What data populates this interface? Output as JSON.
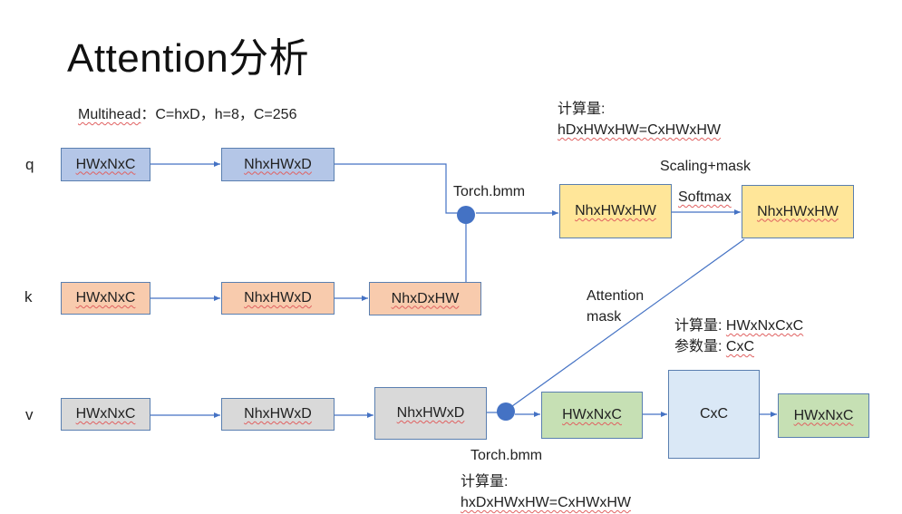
{
  "title": "Attention分析",
  "subtitle": {
    "term": "Multihead",
    "rest": "：C=hxD，h=8，C=256"
  },
  "rows": {
    "q": "q",
    "k": "k",
    "v": "v"
  },
  "boxes": {
    "q1": "HWxNxC",
    "q2": "NhxHWxD",
    "k1": "HWxNxC",
    "k2": "NhxHWxD",
    "k3": "NhxDxHW",
    "v1": "HWxNxC",
    "v2": "NhxHWxD",
    "v3": "NhxHWxD",
    "attn1": "NhxHWxHW",
    "attn2": "NhxHWxHW",
    "out1": "HWxNxC",
    "proj": "CxC",
    "out2": "HWxNxC"
  },
  "labels": {
    "bmm_top": "Torch.bmm",
    "bmm_bottom": "Torch.bmm",
    "scaling": "Scaling+mask",
    "softmax": "Softmax",
    "attn_mask_1": "Attention",
    "attn_mask_2": "mask"
  },
  "notes": {
    "top_label": "计算量:",
    "top_formula": "hDxHWxHW=CxHWxHW",
    "mid_label1": "计算量: ",
    "mid_formula1": "HWxNxCxC",
    "mid_label2": "参数量: ",
    "mid_formula2": "CxC",
    "bottom_label": "计算量:",
    "bottom_formula": "hxDxHWxHW=CxHWxHW"
  },
  "colors": {
    "line": "#4472c4",
    "node": "#4472c4",
    "blue_box": "#b4c6e7",
    "orange_box": "#f8cbad",
    "gray_box": "#d9d9d9",
    "yellow_box": "#ffe699",
    "green_box": "#c6e0b4",
    "light_blue_box": "#dae8f6"
  }
}
